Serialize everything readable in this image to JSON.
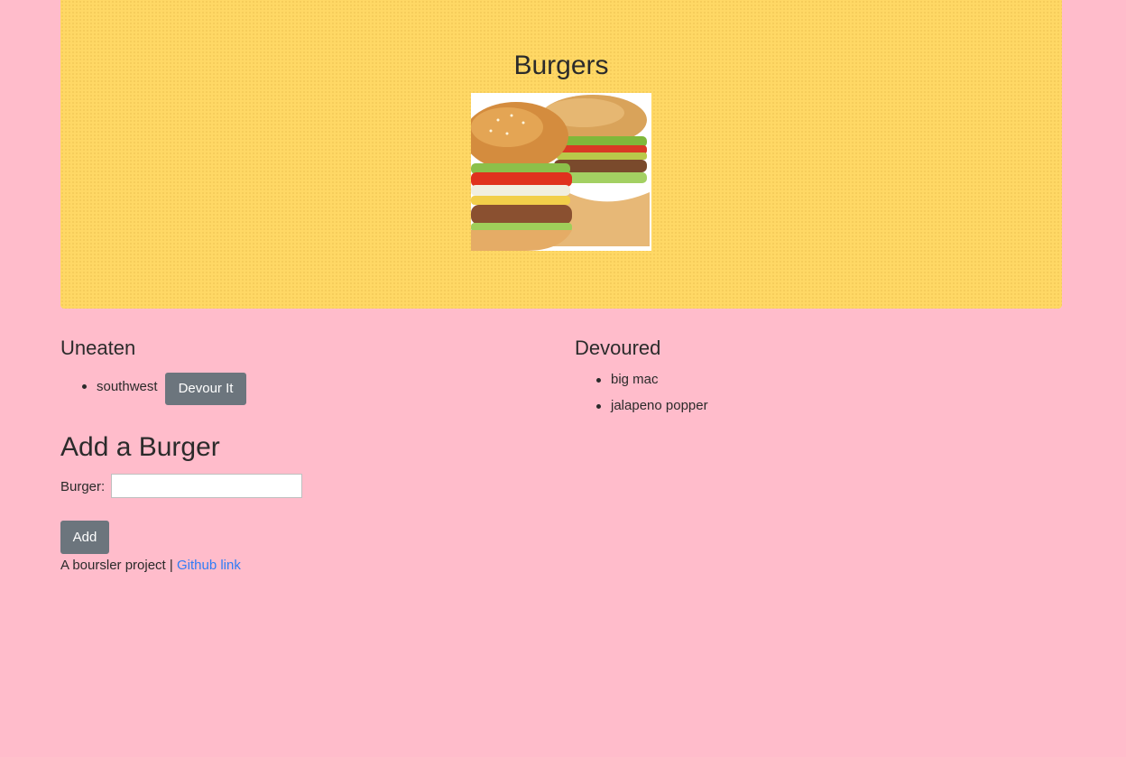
{
  "header": {
    "title": "Burgers"
  },
  "uneaten": {
    "title": "Uneaten",
    "items": [
      {
        "name": "southwest",
        "button_label": "Devour It"
      }
    ]
  },
  "devoured": {
    "title": "Devoured",
    "items": [
      "big mac",
      "jalapeno popper"
    ]
  },
  "add_form": {
    "title": "Add a Burger",
    "label": "Burger:",
    "input_value": "",
    "button_label": "Add"
  },
  "footer": {
    "text": "A boursler project |",
    "link_text": "Github link"
  },
  "colors": {
    "background": "#ffbccb",
    "jumbotron": "#ffd865",
    "button": "#6c757d",
    "link": "#2f7cf6"
  }
}
